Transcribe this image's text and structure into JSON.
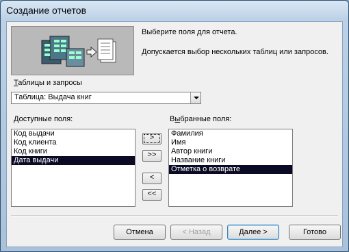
{
  "window": {
    "title": "Создание отчетов"
  },
  "header": {
    "line1": "Выберите поля для отчета.",
    "line2": "Допускается выбор нескольких таблиц или запросов."
  },
  "source": {
    "label_prefix": "",
    "label_hotkey": "Т",
    "label_rest": "аблицы и запросы",
    "selected": "Таблица: Выдача книг"
  },
  "available": {
    "label_prefix": "",
    "label_hotkey": "Д",
    "label_rest": "оступные поля:",
    "items": [
      "Код выдачи",
      "Код клиента",
      "Код книги",
      "Дата выдачи"
    ],
    "selected_index": 3
  },
  "selected_fields": {
    "label_prefix": "В",
    "label_hotkey": "ы",
    "label_rest": "бранные поля:",
    "items": [
      "Фамилия",
      "Имя",
      "Автор книги",
      "Название книги",
      "Отметка о возврате"
    ],
    "selected_index": 4
  },
  "movers": {
    "add": ">",
    "add_all": ">>",
    "remove": "<",
    "remove_all": "<<"
  },
  "buttons": {
    "cancel": "Отмена",
    "back": "< Назад",
    "next": "Далее >",
    "finish": "Готово"
  }
}
